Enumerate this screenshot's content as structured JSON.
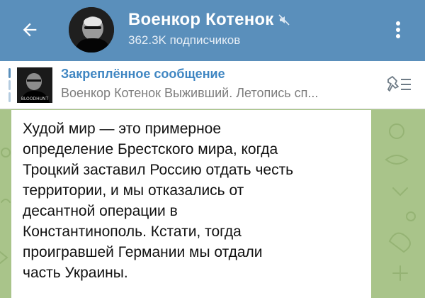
{
  "header": {
    "channel_title": "Военкор Котенок",
    "subscribers": "362.3K подписчиков",
    "muted": true
  },
  "pinned": {
    "label": "Закреплённое сообщение",
    "preview": "Военкор Котенок Выживший. Летопись сп...",
    "thumb_caption": "BLOODHUNT"
  },
  "message": {
    "text": "Худой мир — это примерное\nопределение Брестского мира, когда\nТроцкий заставил Россию отдать честь\nтерритории, и мы отказались от\nдесантной операции в\nКонстантинополь. Кстати, тогда\nпроигравшей Германии мы отдали\nчасть Украины."
  },
  "colors": {
    "header_bg": "#5a8fbb",
    "accent": "#3f86c2",
    "chat_bg": "#a9c48a"
  }
}
